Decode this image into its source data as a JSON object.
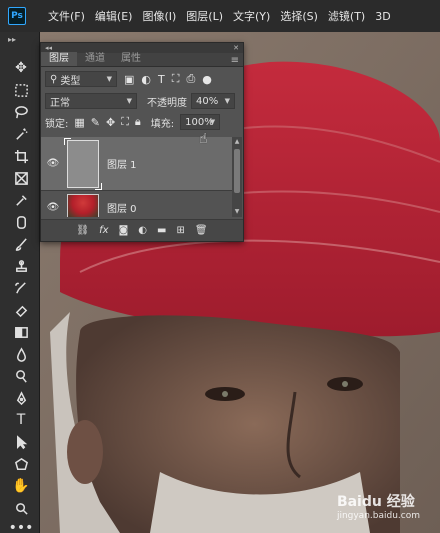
{
  "app": {
    "logo": "Ps"
  },
  "menu": [
    "文件(F)",
    "编辑(E)",
    "图像(I)",
    "图层(L)",
    "文字(Y)",
    "选择(S)",
    "滤镜(T)",
    "3D"
  ],
  "tools": [
    "move-icon",
    "marquee-icon",
    "lasso-icon",
    "quick-select-icon",
    "crop-icon",
    "frame-icon",
    "eyedropper-icon",
    "healing-icon",
    "brush-icon",
    "stamp-icon",
    "history-brush-icon",
    "eraser-icon",
    "gradient-icon",
    "blur-icon",
    "dodge-icon",
    "pen-icon",
    "type-icon",
    "path-select-icon",
    "shape-icon",
    "hand-icon",
    "zoom-icon",
    "more-icon"
  ],
  "layers_panel": {
    "tabs": [
      "图层",
      "通道",
      "属性"
    ],
    "filter": {
      "label": "类型"
    },
    "blend_mode": "正常",
    "opacity": {
      "label": "不透明度",
      "value": "40%"
    },
    "lock_label": "锁定:",
    "fill": {
      "label": "填充:",
      "value": "100%"
    },
    "layers": [
      {
        "name": "图层 1",
        "selected": true
      },
      {
        "name": "图层 0",
        "selected": false
      }
    ],
    "bottom_icons": [
      "link-icon",
      "fx-icon",
      "mask-icon",
      "adjustment-icon",
      "group-icon",
      "new-layer-icon",
      "trash-icon"
    ]
  },
  "watermark": {
    "main": "Baidu 经验",
    "url": "jingyan.baidu.com"
  },
  "colors": {
    "photoshop_blue": "#31a8ff",
    "panel_bg": "#535353",
    "turban_red": "#b8243a"
  }
}
